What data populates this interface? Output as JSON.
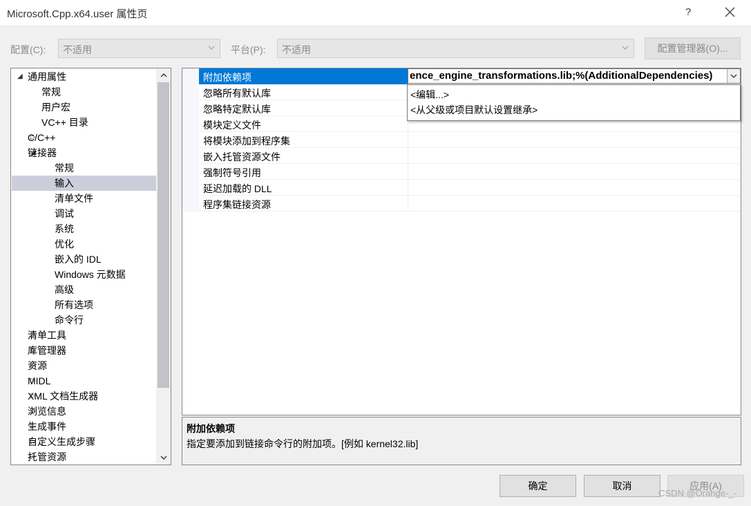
{
  "window": {
    "title": "Microsoft.Cpp.x64.user 属性页",
    "help": "?"
  },
  "toolbar": {
    "config_label": "配置(C):",
    "config_value": "不适用",
    "platform_label": "平台(P):",
    "platform_value": "不适用",
    "config_manager": "配置管理器(O)..."
  },
  "tree": {
    "items": [
      {
        "label": "通用属性",
        "twisty": "◢"
      },
      {
        "label": "常规",
        "twisty": ""
      },
      {
        "label": "用户宏",
        "twisty": ""
      },
      {
        "label": "VC++ 目录",
        "twisty": ""
      },
      {
        "label": "C/C++",
        "twisty": "▷"
      },
      {
        "label": "链接器",
        "twisty": "◢"
      },
      {
        "label": "常规",
        "twisty": ""
      },
      {
        "label": "输入",
        "twisty": ""
      },
      {
        "label": "清单文件",
        "twisty": ""
      },
      {
        "label": "调试",
        "twisty": ""
      },
      {
        "label": "系统",
        "twisty": ""
      },
      {
        "label": "优化",
        "twisty": ""
      },
      {
        "label": "嵌入的 IDL",
        "twisty": ""
      },
      {
        "label": "Windows 元数据",
        "twisty": ""
      },
      {
        "label": "高级",
        "twisty": ""
      },
      {
        "label": "所有选项",
        "twisty": ""
      },
      {
        "label": "命令行",
        "twisty": ""
      },
      {
        "label": "清单工具",
        "twisty": "▷"
      },
      {
        "label": "库管理器",
        "twisty": "▷"
      },
      {
        "label": "资源",
        "twisty": "▷"
      },
      {
        "label": "MIDL",
        "twisty": "▷"
      },
      {
        "label": "XML 文档生成器",
        "twisty": "▷"
      },
      {
        "label": "浏览信息",
        "twisty": "▷"
      },
      {
        "label": "生成事件",
        "twisty": "▷"
      },
      {
        "label": "自定义生成步骤",
        "twisty": "▷"
      },
      {
        "label": "托管资源",
        "twisty": "▷"
      }
    ],
    "selected": "输入"
  },
  "grid": {
    "rows": [
      {
        "name": "附加依赖项"
      },
      {
        "name": "忽略所有默认库"
      },
      {
        "name": "忽略特定默认库"
      },
      {
        "name": "模块定义文件"
      },
      {
        "name": "将模块添加到程序集"
      },
      {
        "name": "嵌入托管资源文件"
      },
      {
        "name": "强制符号引用"
      },
      {
        "name": "延迟加载的 DLL"
      },
      {
        "name": "程序集链接资源"
      }
    ],
    "selected_value": "ence_engine_transformations.lib;%(AdditionalDependencies)",
    "dropdown_options": [
      "<编辑...>",
      "<从父级或项目默认设置继承>"
    ]
  },
  "description": {
    "title": "附加依赖项",
    "text": "指定要添加到链接命令行的附加项。[例如 kernel32.lib]"
  },
  "buttons": {
    "ok": "确定",
    "cancel": "取消",
    "apply": "应用(A)"
  },
  "watermark": "CSDN @Orange-_-",
  "colors": {
    "selection": "#0078d7",
    "tree_selection": "#cccedb",
    "background": "#f0f0f0"
  }
}
